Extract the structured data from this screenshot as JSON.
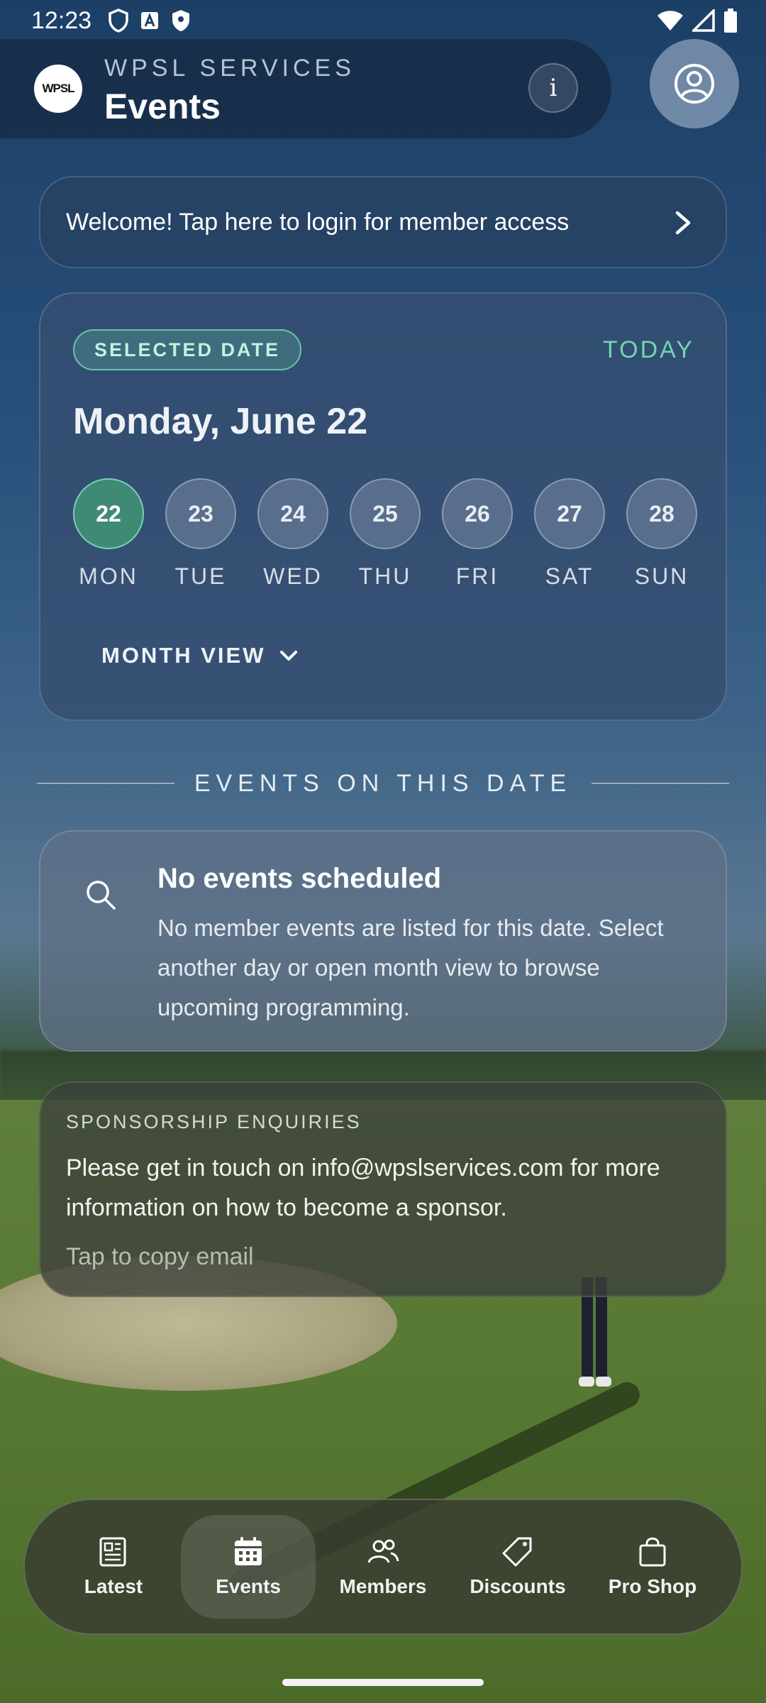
{
  "status_bar": {
    "time": "12:23"
  },
  "header": {
    "logo_text": "WPSL",
    "subtitle": "WPSL SERVICES",
    "title": "Events",
    "info_label": "i"
  },
  "login_banner": {
    "text": "Welcome! Tap here to login for member access"
  },
  "date_picker": {
    "badge": "SELECTED DATE",
    "today_label": "TODAY",
    "date_title": "Monday, June 22",
    "days": [
      {
        "num": "22",
        "name": "MON",
        "selected": true
      },
      {
        "num": "23",
        "name": "TUE",
        "selected": false
      },
      {
        "num": "24",
        "name": "WED",
        "selected": false
      },
      {
        "num": "25",
        "name": "THU",
        "selected": false
      },
      {
        "num": "26",
        "name": "FRI",
        "selected": false
      },
      {
        "num": "27",
        "name": "SAT",
        "selected": false
      },
      {
        "num": "28",
        "name": "SUN",
        "selected": false
      }
    ],
    "month_view_label": "MONTH VIEW"
  },
  "events_section": {
    "heading": "EVENTS ON THIS DATE",
    "empty_title": "No events scheduled",
    "empty_body": "No member events are listed for this date. Select another day or open month view to browse upcoming programming."
  },
  "sponsorship": {
    "label": "SPONSORSHIP ENQUIRIES",
    "body": "Please get in touch on info@wpslservices.com for more information on how to become a sponsor.",
    "copy_label": "Tap to copy email"
  },
  "bottom_nav": {
    "items": [
      {
        "label": "Latest",
        "icon": "news-icon",
        "active": false
      },
      {
        "label": "Events",
        "icon": "calendar-icon",
        "active": true
      },
      {
        "label": "Members",
        "icon": "people-icon",
        "active": false
      },
      {
        "label": "Discounts",
        "icon": "tag-icon",
        "active": false
      },
      {
        "label": "Pro Shop",
        "icon": "shopping-bag-icon",
        "active": false
      }
    ]
  },
  "colors": {
    "accent": "#6fd6b1",
    "selected_day": "#3f8a74",
    "header_bg": "#182c48"
  }
}
